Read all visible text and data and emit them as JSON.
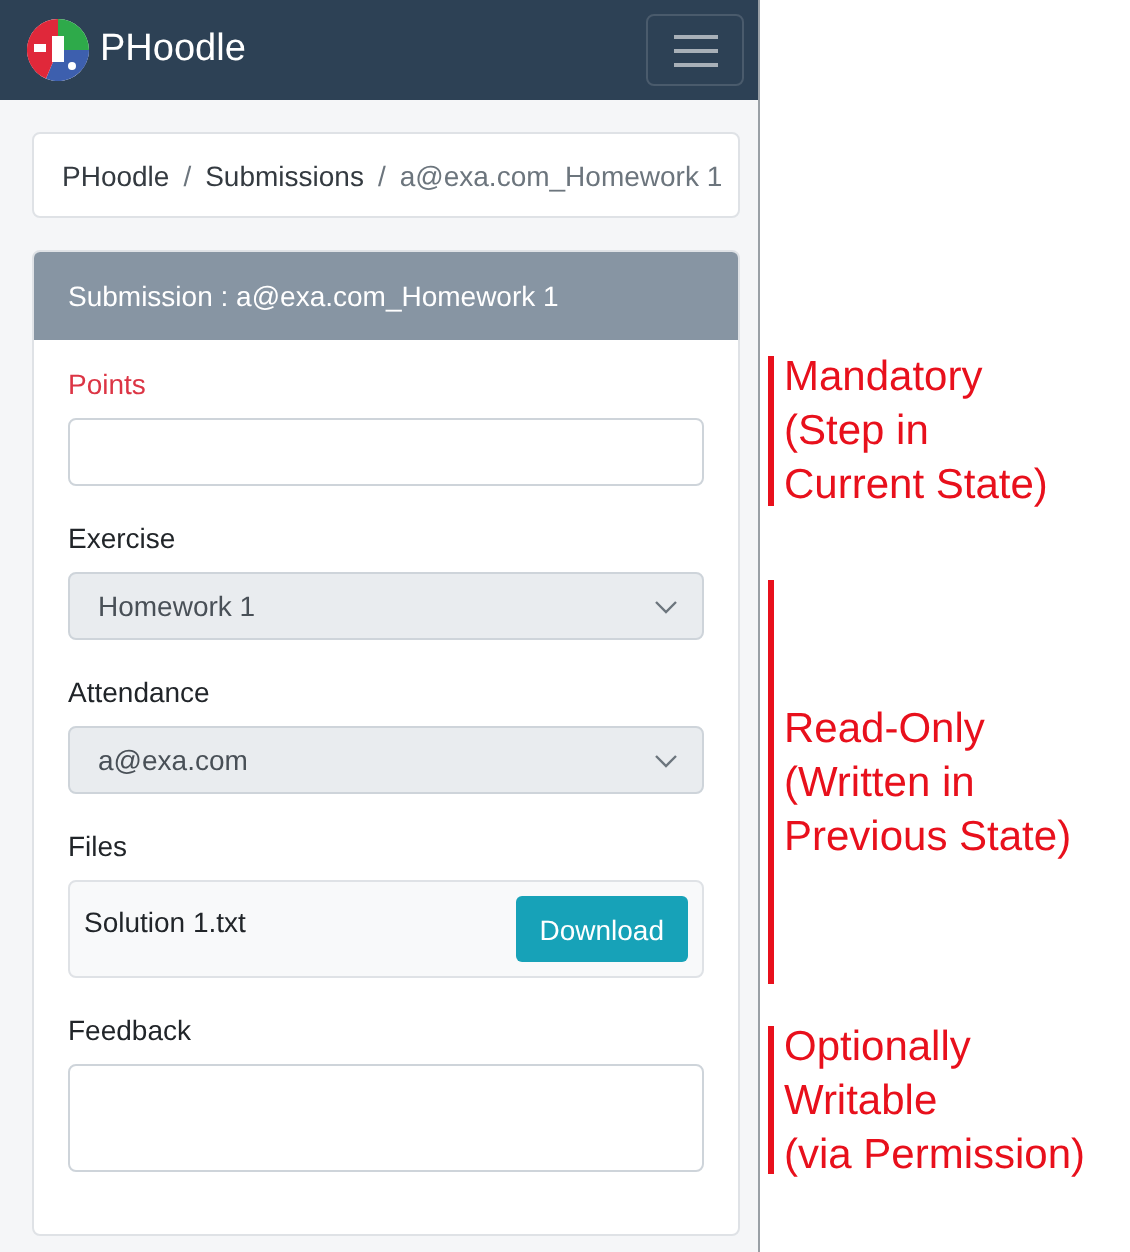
{
  "navbar": {
    "brand": "PHoodle"
  },
  "breadcrumb": {
    "separator": "/",
    "items": [
      "PHoodle",
      "Submissions",
      "a@exa.com_Homework 1"
    ]
  },
  "card": {
    "title": "Submission : a@exa.com_Homework 1"
  },
  "fields": [
    {
      "kind": "input",
      "label": "Points",
      "required": true,
      "disabled": false
    },
    {
      "kind": "select",
      "label": "Exercise",
      "required": false,
      "disabled": true,
      "value": "Homework 1"
    },
    {
      "kind": "select",
      "label": "Attendance",
      "required": false,
      "disabled": true,
      "value": "a@exa.com"
    },
    {
      "kind": "files",
      "label": "Files",
      "required": false,
      "file": "Solution 1.txt",
      "button": "Download"
    },
    {
      "kind": "textarea",
      "label": "Feedback",
      "required": false,
      "disabled": false
    }
  ],
  "annotations": [
    {
      "text": "Mandatory\n(Step in\nCurrent State)"
    },
    {
      "text": "Read-Only\n(Written in\nPrevious State)"
    },
    {
      "text": "Optionally\nWritable\n(via Permission)"
    }
  ]
}
